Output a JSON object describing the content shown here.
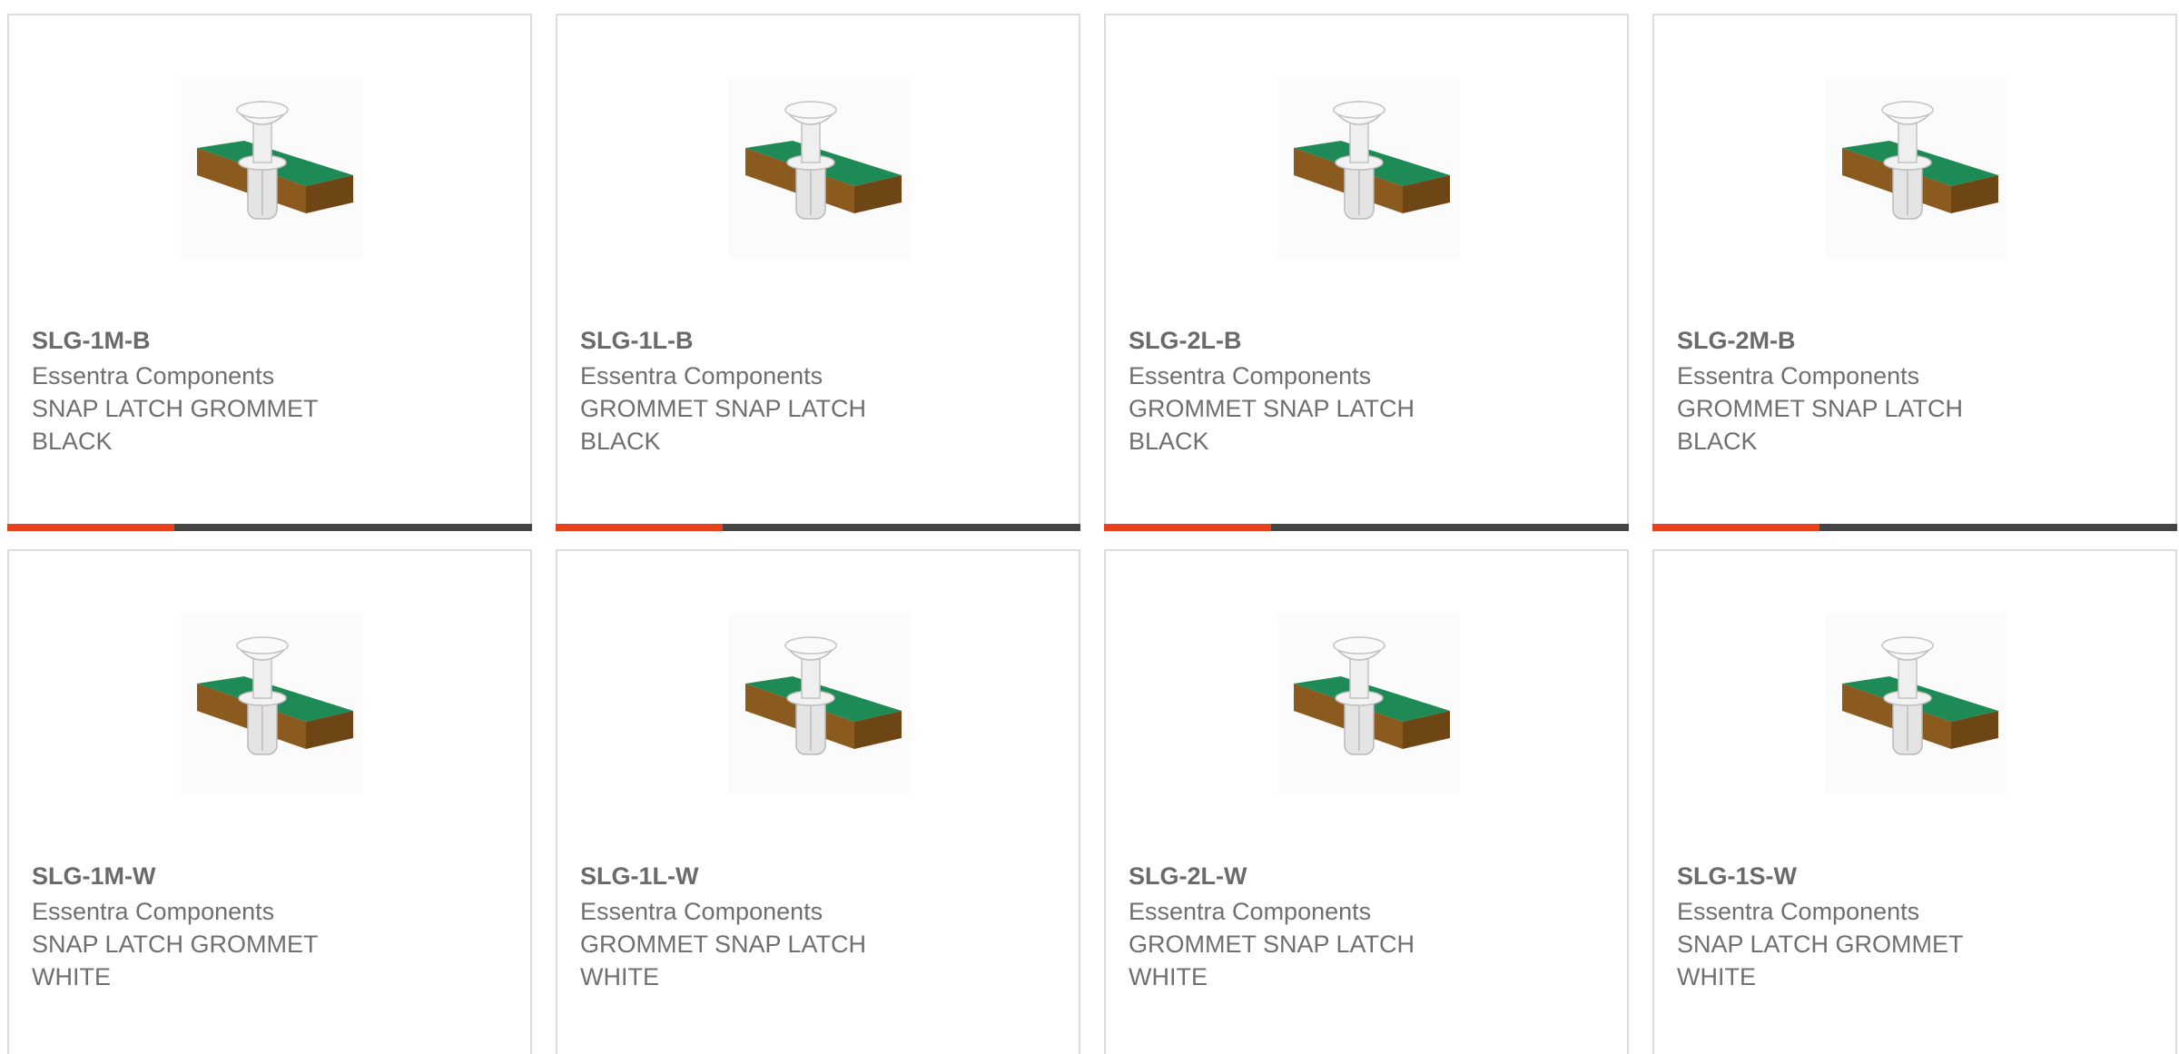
{
  "products": [
    {
      "part_number": "SLG-1M-B",
      "manufacturer": "Essentra Components",
      "description": "SNAP LATCH GROMMET",
      "color": "BLACK",
      "image_icon": "snap-latch-grommet-icon"
    },
    {
      "part_number": "SLG-1L-B",
      "manufacturer": "Essentra Components",
      "description": "GROMMET SNAP LATCH",
      "color": "BLACK",
      "image_icon": "snap-latch-grommet-icon"
    },
    {
      "part_number": "SLG-2L-B",
      "manufacturer": "Essentra Components",
      "description": "GROMMET SNAP LATCH",
      "color": "BLACK",
      "image_icon": "snap-latch-grommet-icon"
    },
    {
      "part_number": "SLG-2M-B",
      "manufacturer": "Essentra Components",
      "description": "GROMMET SNAP LATCH",
      "color": "BLACK",
      "image_icon": "snap-latch-grommet-icon"
    },
    {
      "part_number": "SLG-1M-W",
      "manufacturer": "Essentra Components",
      "description": "SNAP LATCH GROMMET",
      "color": "WHITE",
      "image_icon": "snap-latch-grommet-icon"
    },
    {
      "part_number": "SLG-1L-W",
      "manufacturer": "Essentra Components",
      "description": "GROMMET SNAP LATCH",
      "color": "WHITE",
      "image_icon": "snap-latch-grommet-icon"
    },
    {
      "part_number": "SLG-2L-W",
      "manufacturer": "Essentra Components",
      "description": "GROMMET SNAP LATCH",
      "color": "WHITE",
      "image_icon": "snap-latch-grommet-icon"
    },
    {
      "part_number": "SLG-1S-W",
      "manufacturer": "Essentra Components",
      "description": "SNAP LATCH GROMMET",
      "color": "WHITE",
      "image_icon": "snap-latch-grommet-icon"
    }
  ],
  "theme": {
    "accent": "#e8401a",
    "bar": "#444444",
    "border": "#dcdcdc",
    "text": "#6f6f6f",
    "board_top": "#1e8a55",
    "board_side": "#8a5a1e"
  }
}
